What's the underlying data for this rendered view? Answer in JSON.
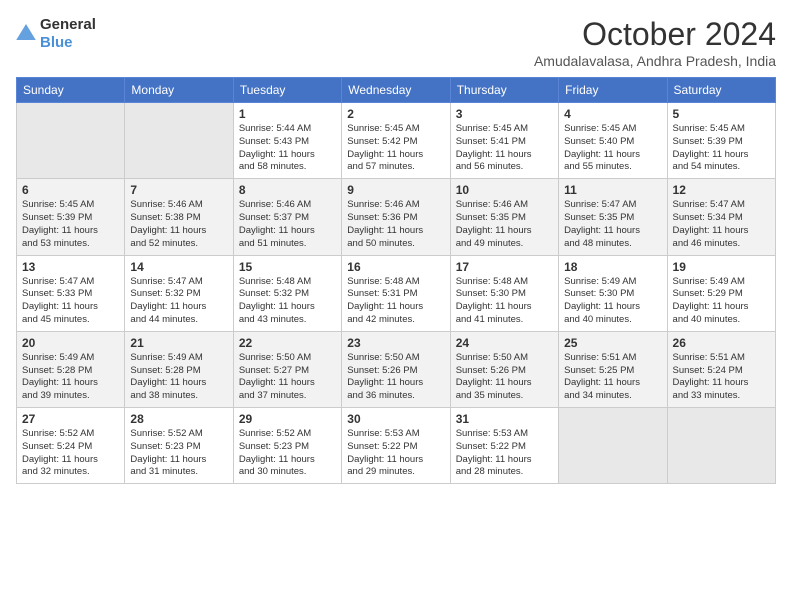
{
  "header": {
    "logo_general": "General",
    "logo_blue": "Blue",
    "month": "October 2024",
    "location": "Amudalavalasa, Andhra Pradesh, India"
  },
  "weekdays": [
    "Sunday",
    "Monday",
    "Tuesday",
    "Wednesday",
    "Thursday",
    "Friday",
    "Saturday"
  ],
  "weeks": [
    [
      {
        "day": "",
        "info": ""
      },
      {
        "day": "",
        "info": ""
      },
      {
        "day": "1",
        "info": "Sunrise: 5:44 AM\nSunset: 5:43 PM\nDaylight: 11 hours\nand 58 minutes."
      },
      {
        "day": "2",
        "info": "Sunrise: 5:45 AM\nSunset: 5:42 PM\nDaylight: 11 hours\nand 57 minutes."
      },
      {
        "day": "3",
        "info": "Sunrise: 5:45 AM\nSunset: 5:41 PM\nDaylight: 11 hours\nand 56 minutes."
      },
      {
        "day": "4",
        "info": "Sunrise: 5:45 AM\nSunset: 5:40 PM\nDaylight: 11 hours\nand 55 minutes."
      },
      {
        "day": "5",
        "info": "Sunrise: 5:45 AM\nSunset: 5:39 PM\nDaylight: 11 hours\nand 54 minutes."
      }
    ],
    [
      {
        "day": "6",
        "info": "Sunrise: 5:45 AM\nSunset: 5:39 PM\nDaylight: 11 hours\nand 53 minutes."
      },
      {
        "day": "7",
        "info": "Sunrise: 5:46 AM\nSunset: 5:38 PM\nDaylight: 11 hours\nand 52 minutes."
      },
      {
        "day": "8",
        "info": "Sunrise: 5:46 AM\nSunset: 5:37 PM\nDaylight: 11 hours\nand 51 minutes."
      },
      {
        "day": "9",
        "info": "Sunrise: 5:46 AM\nSunset: 5:36 PM\nDaylight: 11 hours\nand 50 minutes."
      },
      {
        "day": "10",
        "info": "Sunrise: 5:46 AM\nSunset: 5:35 PM\nDaylight: 11 hours\nand 49 minutes."
      },
      {
        "day": "11",
        "info": "Sunrise: 5:47 AM\nSunset: 5:35 PM\nDaylight: 11 hours\nand 48 minutes."
      },
      {
        "day": "12",
        "info": "Sunrise: 5:47 AM\nSunset: 5:34 PM\nDaylight: 11 hours\nand 46 minutes."
      }
    ],
    [
      {
        "day": "13",
        "info": "Sunrise: 5:47 AM\nSunset: 5:33 PM\nDaylight: 11 hours\nand 45 minutes."
      },
      {
        "day": "14",
        "info": "Sunrise: 5:47 AM\nSunset: 5:32 PM\nDaylight: 11 hours\nand 44 minutes."
      },
      {
        "day": "15",
        "info": "Sunrise: 5:48 AM\nSunset: 5:32 PM\nDaylight: 11 hours\nand 43 minutes."
      },
      {
        "day": "16",
        "info": "Sunrise: 5:48 AM\nSunset: 5:31 PM\nDaylight: 11 hours\nand 42 minutes."
      },
      {
        "day": "17",
        "info": "Sunrise: 5:48 AM\nSunset: 5:30 PM\nDaylight: 11 hours\nand 41 minutes."
      },
      {
        "day": "18",
        "info": "Sunrise: 5:49 AM\nSunset: 5:30 PM\nDaylight: 11 hours\nand 40 minutes."
      },
      {
        "day": "19",
        "info": "Sunrise: 5:49 AM\nSunset: 5:29 PM\nDaylight: 11 hours\nand 40 minutes."
      }
    ],
    [
      {
        "day": "20",
        "info": "Sunrise: 5:49 AM\nSunset: 5:28 PM\nDaylight: 11 hours\nand 39 minutes."
      },
      {
        "day": "21",
        "info": "Sunrise: 5:49 AM\nSunset: 5:28 PM\nDaylight: 11 hours\nand 38 minutes."
      },
      {
        "day": "22",
        "info": "Sunrise: 5:50 AM\nSunset: 5:27 PM\nDaylight: 11 hours\nand 37 minutes."
      },
      {
        "day": "23",
        "info": "Sunrise: 5:50 AM\nSunset: 5:26 PM\nDaylight: 11 hours\nand 36 minutes."
      },
      {
        "day": "24",
        "info": "Sunrise: 5:50 AM\nSunset: 5:26 PM\nDaylight: 11 hours\nand 35 minutes."
      },
      {
        "day": "25",
        "info": "Sunrise: 5:51 AM\nSunset: 5:25 PM\nDaylight: 11 hours\nand 34 minutes."
      },
      {
        "day": "26",
        "info": "Sunrise: 5:51 AM\nSunset: 5:24 PM\nDaylight: 11 hours\nand 33 minutes."
      }
    ],
    [
      {
        "day": "27",
        "info": "Sunrise: 5:52 AM\nSunset: 5:24 PM\nDaylight: 11 hours\nand 32 minutes."
      },
      {
        "day": "28",
        "info": "Sunrise: 5:52 AM\nSunset: 5:23 PM\nDaylight: 11 hours\nand 31 minutes."
      },
      {
        "day": "29",
        "info": "Sunrise: 5:52 AM\nSunset: 5:23 PM\nDaylight: 11 hours\nand 30 minutes."
      },
      {
        "day": "30",
        "info": "Sunrise: 5:53 AM\nSunset: 5:22 PM\nDaylight: 11 hours\nand 29 minutes."
      },
      {
        "day": "31",
        "info": "Sunrise: 5:53 AM\nSunset: 5:22 PM\nDaylight: 11 hours\nand 28 minutes."
      },
      {
        "day": "",
        "info": ""
      },
      {
        "day": "",
        "info": ""
      }
    ]
  ]
}
